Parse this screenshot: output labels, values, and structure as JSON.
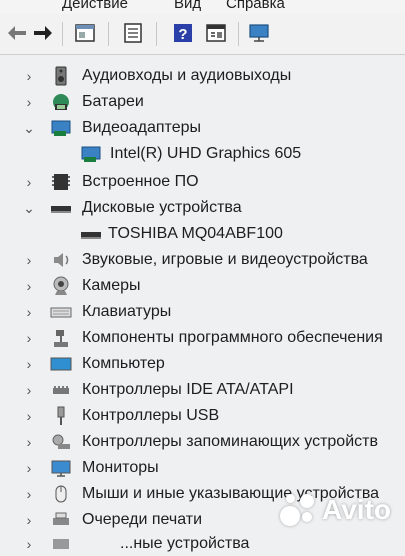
{
  "menu": {
    "action": "Действие",
    "view": "Вид",
    "help": "Справка"
  },
  "toolbar": {
    "icons": [
      "back-arrow-icon",
      "forward-arrow-icon",
      "properties-icon",
      "details-icon",
      "help-icon",
      "view-icon",
      "monitor-icon"
    ]
  },
  "tree": {
    "items": [
      {
        "label": "Аудиовходы и аудиовыходы",
        "expanded": false,
        "icon": "speaker-icon"
      },
      {
        "label": "Батареи",
        "expanded": false,
        "icon": "battery-icon"
      },
      {
        "label": "Видеоадаптеры",
        "expanded": true,
        "icon": "display-adapter-icon"
      },
      {
        "label": "Intel(R) UHD Graphics 605",
        "child": true,
        "icon": "display-adapter-icon"
      },
      {
        "label": "Встроенное ПО",
        "expanded": false,
        "icon": "firmware-icon"
      },
      {
        "label": "Дисковые устройства",
        "expanded": true,
        "icon": "disk-drive-icon"
      },
      {
        "label": "TOSHIBA MQ04ABF100",
        "child": true,
        "icon": "disk-drive-icon"
      },
      {
        "label": "Звуковые, игровые и видеоустройства",
        "expanded": false,
        "icon": "sound-icon"
      },
      {
        "label": "Камеры",
        "expanded": false,
        "icon": "camera-icon"
      },
      {
        "label": "Клавиатуры",
        "expanded": false,
        "icon": "keyboard-icon"
      },
      {
        "label": "Компоненты программного обеспечения",
        "expanded": false,
        "icon": "software-component-icon"
      },
      {
        "label": "Компьютер",
        "expanded": false,
        "icon": "computer-icon"
      },
      {
        "label": "Контроллеры IDE ATA/ATAPI",
        "expanded": false,
        "icon": "ide-controller-icon"
      },
      {
        "label": "Контроллеры USB",
        "expanded": false,
        "icon": "usb-icon"
      },
      {
        "label": "Контроллеры запоминающих устройств",
        "expanded": false,
        "icon": "storage-controller-icon"
      },
      {
        "label": "Мониторы",
        "expanded": false,
        "icon": "monitor-icon"
      },
      {
        "label": "Мыши и иные указывающие устройства",
        "expanded": false,
        "icon": "mouse-icon"
      },
      {
        "label": "Очереди печати",
        "expanded": false,
        "icon": "print-queue-icon"
      },
      {
        "label": "...ные устройства",
        "expanded": false,
        "icon": "device-icon"
      }
    ]
  },
  "watermark": {
    "text": "Avito"
  },
  "colors": {
    "accent": "#2f6fb0",
    "chip": "#1a7f3c",
    "background": "#eef0f2"
  }
}
